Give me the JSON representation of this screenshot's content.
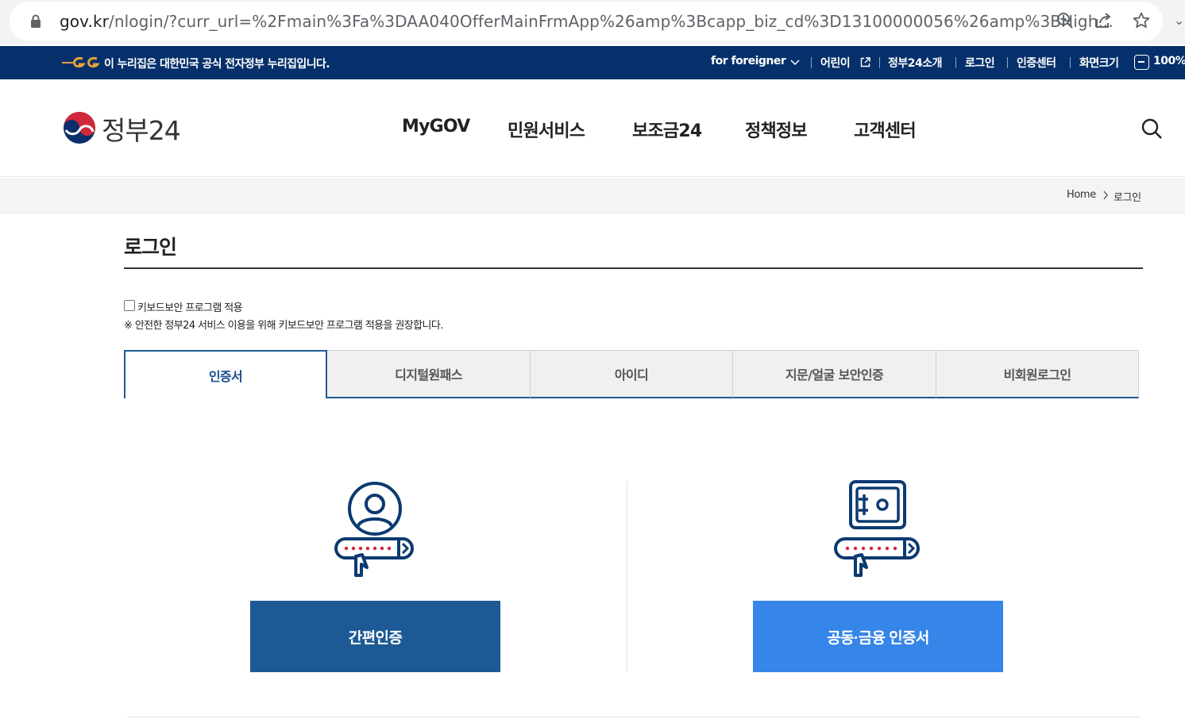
{
  "browser": {
    "url_host": "gov.kr",
    "url_rest": "/nlogin/?curr_url=%2Fmain%3Fa%3DAA040OfferMainFrmApp%26amp%3Bcapp_biz_cd%3D13100000056%26amp%3BHigh..."
  },
  "gov_banner": {
    "notice": "이 누리집은 대한민국 공식 전자정부 누리집입니다.",
    "links": {
      "foreigner": "for foreigner",
      "kids": "어린이",
      "about": "정부24소개",
      "login": "로그인",
      "cert_center": "인증센터",
      "zoom": "화면크기",
      "zoom_value": "100%"
    }
  },
  "header": {
    "logo_text": "정부24",
    "nav": [
      "MyGOV",
      "민원서비스",
      "보조금24",
      "정책정보",
      "고객센터"
    ]
  },
  "breadcrumb": {
    "home": "Home",
    "current": "로그인"
  },
  "page": {
    "title": "로그인",
    "keyboard_security_label": "키보드보안 프로그램 적용",
    "keyboard_security_note": "※ 안전한 정부24 서비스 이용을 위해 키보드보안 프로그램 적용을 권장합니다."
  },
  "tabs": [
    "인증서",
    "디지털원패스",
    "아이디",
    "지문/얼굴 보안인증",
    "비회원로그인"
  ],
  "login_options": {
    "easy_auth_label": "간편인증",
    "joint_cert_label": "공동·금융 인증서"
  },
  "colors": {
    "gov_navy": "#06306b",
    "tab_active": "#1c4f8c",
    "easy_button": "#1d5994",
    "cert_button": "#3685e8",
    "icon_accent": "#d0283a"
  }
}
